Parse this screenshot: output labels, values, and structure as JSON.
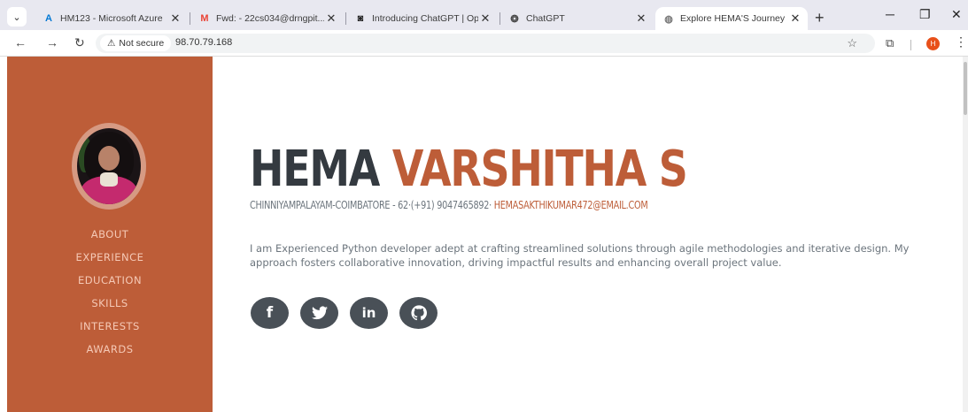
{
  "browser": {
    "tabs": [
      {
        "favicon": "azure-icon",
        "favicon_glyph": "A",
        "favicon_color": "#0078d4",
        "title": "HM123 - Microsoft Azure",
        "active": false
      },
      {
        "favicon": "gmail-icon",
        "favicon_glyph": "M",
        "favicon_color": "#ea4335",
        "title": "Fwd: - 22cs034@drngpit...",
        "active": false
      },
      {
        "favicon": "openai-icon",
        "favicon_glyph": "◙",
        "favicon_color": "#222222",
        "title": "Introducing ChatGPT | Op",
        "active": false
      },
      {
        "favicon": "chatgpt-icon",
        "favicon_glyph": "❂",
        "favicon_color": "#444444",
        "title": "ChatGPT",
        "active": false
      },
      {
        "favicon": "globe-icon",
        "favicon_glyph": "◍",
        "favicon_color": "#777777",
        "title": "Explore HEMA'S Journey",
        "active": true
      }
    ],
    "close_glyph": "✕",
    "new_tab_glyph": "+",
    "security_label": "Not secure",
    "url": "98.70.79.168",
    "profile_initial": "H"
  },
  "sidebar": {
    "nav": [
      "About",
      "Experience",
      "Education",
      "Skills",
      "Interests",
      "Awards"
    ],
    "accent_color": "#bd5d38"
  },
  "hero": {
    "first_name": "HEMA",
    "last_name": "VARSHITHA S",
    "address": "CHINNIYAMPALAYAM-COIMBATORE - 62·(+91) 9047465892·",
    "email": "HEMASAKTHIKUMAR472@EMAIL.COM",
    "about": "I am Experienced Python developer adept at crafting streamlined solutions through agile methodologies and iterative design. My approach fosters collaborative innovation, driving impactful results and enhancing overall project value.",
    "socials": [
      {
        "name": "facebook-icon",
        "glyph": "f"
      },
      {
        "name": "twitter-icon",
        "glyph": "🐦"
      },
      {
        "name": "linkedin-icon",
        "glyph": "in"
      },
      {
        "name": "github-icon",
        "glyph": "◉"
      }
    ]
  }
}
